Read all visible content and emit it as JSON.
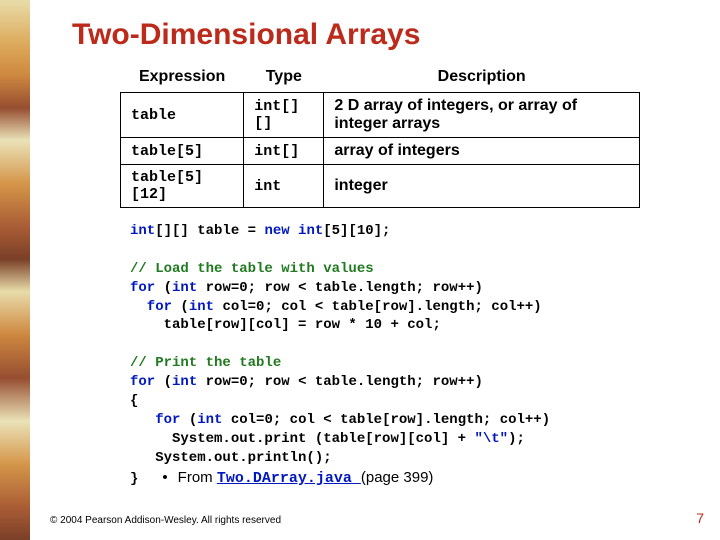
{
  "title": "Two-Dimensional Arrays",
  "headers": {
    "c0": "Expression",
    "c1": "Type",
    "c2": "Description"
  },
  "rows": [
    {
      "expr": "table",
      "type": "int[][]",
      "desc": "2 D array of integers, or array of integer arrays"
    },
    {
      "expr": "table[5]",
      "type": "int[]",
      "desc": "array of integers"
    },
    {
      "expr": "table[5][12]",
      "type": "int",
      "desc": "integer"
    }
  ],
  "code1_pre": "int",
  "code1_post": "[][] table = ",
  "code1_new": "new int",
  "code1_tail": "[5][10];",
  "cmt_load": "// Load the table with values",
  "for1a": "for",
  "for1b": " (",
  "for1c": "int",
  "for1d": " row=0; row < table.length; row++)",
  "for2a": "  for",
  "for2b": " (",
  "for2c": "int",
  "for2d": " col=0; col < table[row].length; col++)",
  "load_body": "    table[row][col] = row * 10 + col;",
  "cmt_print": "// Print the table",
  "pfor1a": "for",
  "pfor1b": " (",
  "pfor1c": "int",
  "pfor1d": " row=0; row < table.length; row++)",
  "brace_o": "{",
  "pfor2a": "   for",
  "pfor2b": " (",
  "pfor2c": "int",
  "pfor2d": " col=0; col < table[row].length; col++)",
  "print_line_a": "     System.out.print (table[row][col] + ",
  "print_str": "\"\\t\"",
  "print_line_b": ");",
  "println": "   System.out.println();",
  "brace_c": "}",
  "from_label": "From ",
  "from_link": "Two.DArray.java ",
  "from_page": "(page 399)",
  "copyright": "© 2004 Pearson Addison-Wesley. All rights reserved",
  "pagenum": "7"
}
